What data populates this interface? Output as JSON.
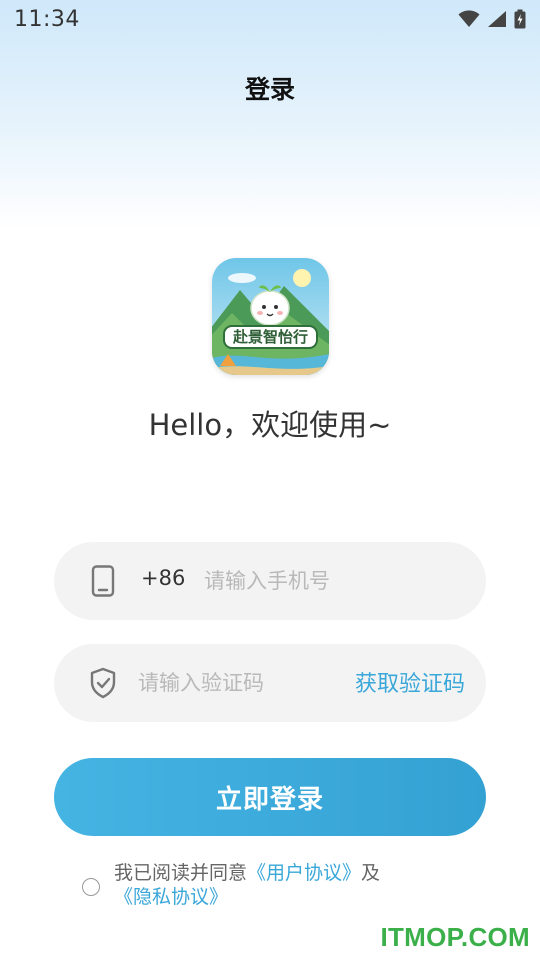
{
  "status_bar": {
    "time": "11:34",
    "icons": [
      "wifi-icon",
      "cell-signal-icon",
      "battery-icon"
    ]
  },
  "header": {
    "title": "登录"
  },
  "app": {
    "logo_text": "赴景智怡行",
    "greeting": "Hello，欢迎使用~"
  },
  "form": {
    "phone": {
      "icon": "phone-icon",
      "prefix": "+86",
      "value": "",
      "placeholder": "请输入手机号"
    },
    "code": {
      "icon": "shield-icon",
      "value": "",
      "placeholder": "请输入验证码",
      "get_code_label": "获取验证码"
    },
    "login_label": "立即登录"
  },
  "agreement": {
    "checked": false,
    "prefix": "我已阅读并同意",
    "user_link": "《用户协议》",
    "connector": "及",
    "privacy_link": "《隐私协议》"
  },
  "watermark": "ITMOP.COM",
  "colors": {
    "accent": "#3aa7d9",
    "button_start": "#45b4e3",
    "button_end": "#34a1d3",
    "field_bg": "#f3f3f3",
    "watermark": "#3bb04a"
  }
}
